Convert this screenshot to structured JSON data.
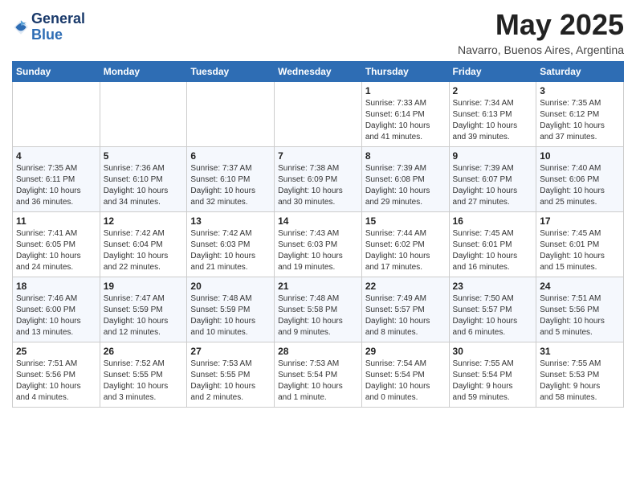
{
  "logo": {
    "line1": "General",
    "line2": "Blue"
  },
  "title": "May 2025",
  "location": "Navarro, Buenos Aires, Argentina",
  "weekdays": [
    "Sunday",
    "Monday",
    "Tuesday",
    "Wednesday",
    "Thursday",
    "Friday",
    "Saturday"
  ],
  "weeks": [
    [
      {
        "day": "",
        "info": ""
      },
      {
        "day": "",
        "info": ""
      },
      {
        "day": "",
        "info": ""
      },
      {
        "day": "",
        "info": ""
      },
      {
        "day": "1",
        "info": "Sunrise: 7:33 AM\nSunset: 6:14 PM\nDaylight: 10 hours\nand 41 minutes."
      },
      {
        "day": "2",
        "info": "Sunrise: 7:34 AM\nSunset: 6:13 PM\nDaylight: 10 hours\nand 39 minutes."
      },
      {
        "day": "3",
        "info": "Sunrise: 7:35 AM\nSunset: 6:12 PM\nDaylight: 10 hours\nand 37 minutes."
      }
    ],
    [
      {
        "day": "4",
        "info": "Sunrise: 7:35 AM\nSunset: 6:11 PM\nDaylight: 10 hours\nand 36 minutes."
      },
      {
        "day": "5",
        "info": "Sunrise: 7:36 AM\nSunset: 6:10 PM\nDaylight: 10 hours\nand 34 minutes."
      },
      {
        "day": "6",
        "info": "Sunrise: 7:37 AM\nSunset: 6:10 PM\nDaylight: 10 hours\nand 32 minutes."
      },
      {
        "day": "7",
        "info": "Sunrise: 7:38 AM\nSunset: 6:09 PM\nDaylight: 10 hours\nand 30 minutes."
      },
      {
        "day": "8",
        "info": "Sunrise: 7:39 AM\nSunset: 6:08 PM\nDaylight: 10 hours\nand 29 minutes."
      },
      {
        "day": "9",
        "info": "Sunrise: 7:39 AM\nSunset: 6:07 PM\nDaylight: 10 hours\nand 27 minutes."
      },
      {
        "day": "10",
        "info": "Sunrise: 7:40 AM\nSunset: 6:06 PM\nDaylight: 10 hours\nand 25 minutes."
      }
    ],
    [
      {
        "day": "11",
        "info": "Sunrise: 7:41 AM\nSunset: 6:05 PM\nDaylight: 10 hours\nand 24 minutes."
      },
      {
        "day": "12",
        "info": "Sunrise: 7:42 AM\nSunset: 6:04 PM\nDaylight: 10 hours\nand 22 minutes."
      },
      {
        "day": "13",
        "info": "Sunrise: 7:42 AM\nSunset: 6:03 PM\nDaylight: 10 hours\nand 21 minutes."
      },
      {
        "day": "14",
        "info": "Sunrise: 7:43 AM\nSunset: 6:03 PM\nDaylight: 10 hours\nand 19 minutes."
      },
      {
        "day": "15",
        "info": "Sunrise: 7:44 AM\nSunset: 6:02 PM\nDaylight: 10 hours\nand 17 minutes."
      },
      {
        "day": "16",
        "info": "Sunrise: 7:45 AM\nSunset: 6:01 PM\nDaylight: 10 hours\nand 16 minutes."
      },
      {
        "day": "17",
        "info": "Sunrise: 7:45 AM\nSunset: 6:01 PM\nDaylight: 10 hours\nand 15 minutes."
      }
    ],
    [
      {
        "day": "18",
        "info": "Sunrise: 7:46 AM\nSunset: 6:00 PM\nDaylight: 10 hours\nand 13 minutes."
      },
      {
        "day": "19",
        "info": "Sunrise: 7:47 AM\nSunset: 5:59 PM\nDaylight: 10 hours\nand 12 minutes."
      },
      {
        "day": "20",
        "info": "Sunrise: 7:48 AM\nSunset: 5:59 PM\nDaylight: 10 hours\nand 10 minutes."
      },
      {
        "day": "21",
        "info": "Sunrise: 7:48 AM\nSunset: 5:58 PM\nDaylight: 10 hours\nand 9 minutes."
      },
      {
        "day": "22",
        "info": "Sunrise: 7:49 AM\nSunset: 5:57 PM\nDaylight: 10 hours\nand 8 minutes."
      },
      {
        "day": "23",
        "info": "Sunrise: 7:50 AM\nSunset: 5:57 PM\nDaylight: 10 hours\nand 6 minutes."
      },
      {
        "day": "24",
        "info": "Sunrise: 7:51 AM\nSunset: 5:56 PM\nDaylight: 10 hours\nand 5 minutes."
      }
    ],
    [
      {
        "day": "25",
        "info": "Sunrise: 7:51 AM\nSunset: 5:56 PM\nDaylight: 10 hours\nand 4 minutes."
      },
      {
        "day": "26",
        "info": "Sunrise: 7:52 AM\nSunset: 5:55 PM\nDaylight: 10 hours\nand 3 minutes."
      },
      {
        "day": "27",
        "info": "Sunrise: 7:53 AM\nSunset: 5:55 PM\nDaylight: 10 hours\nand 2 minutes."
      },
      {
        "day": "28",
        "info": "Sunrise: 7:53 AM\nSunset: 5:54 PM\nDaylight: 10 hours\nand 1 minute."
      },
      {
        "day": "29",
        "info": "Sunrise: 7:54 AM\nSunset: 5:54 PM\nDaylight: 10 hours\nand 0 minutes."
      },
      {
        "day": "30",
        "info": "Sunrise: 7:55 AM\nSunset: 5:54 PM\nDaylight: 9 hours\nand 59 minutes."
      },
      {
        "day": "31",
        "info": "Sunrise: 7:55 AM\nSunset: 5:53 PM\nDaylight: 9 hours\nand 58 minutes."
      }
    ]
  ]
}
